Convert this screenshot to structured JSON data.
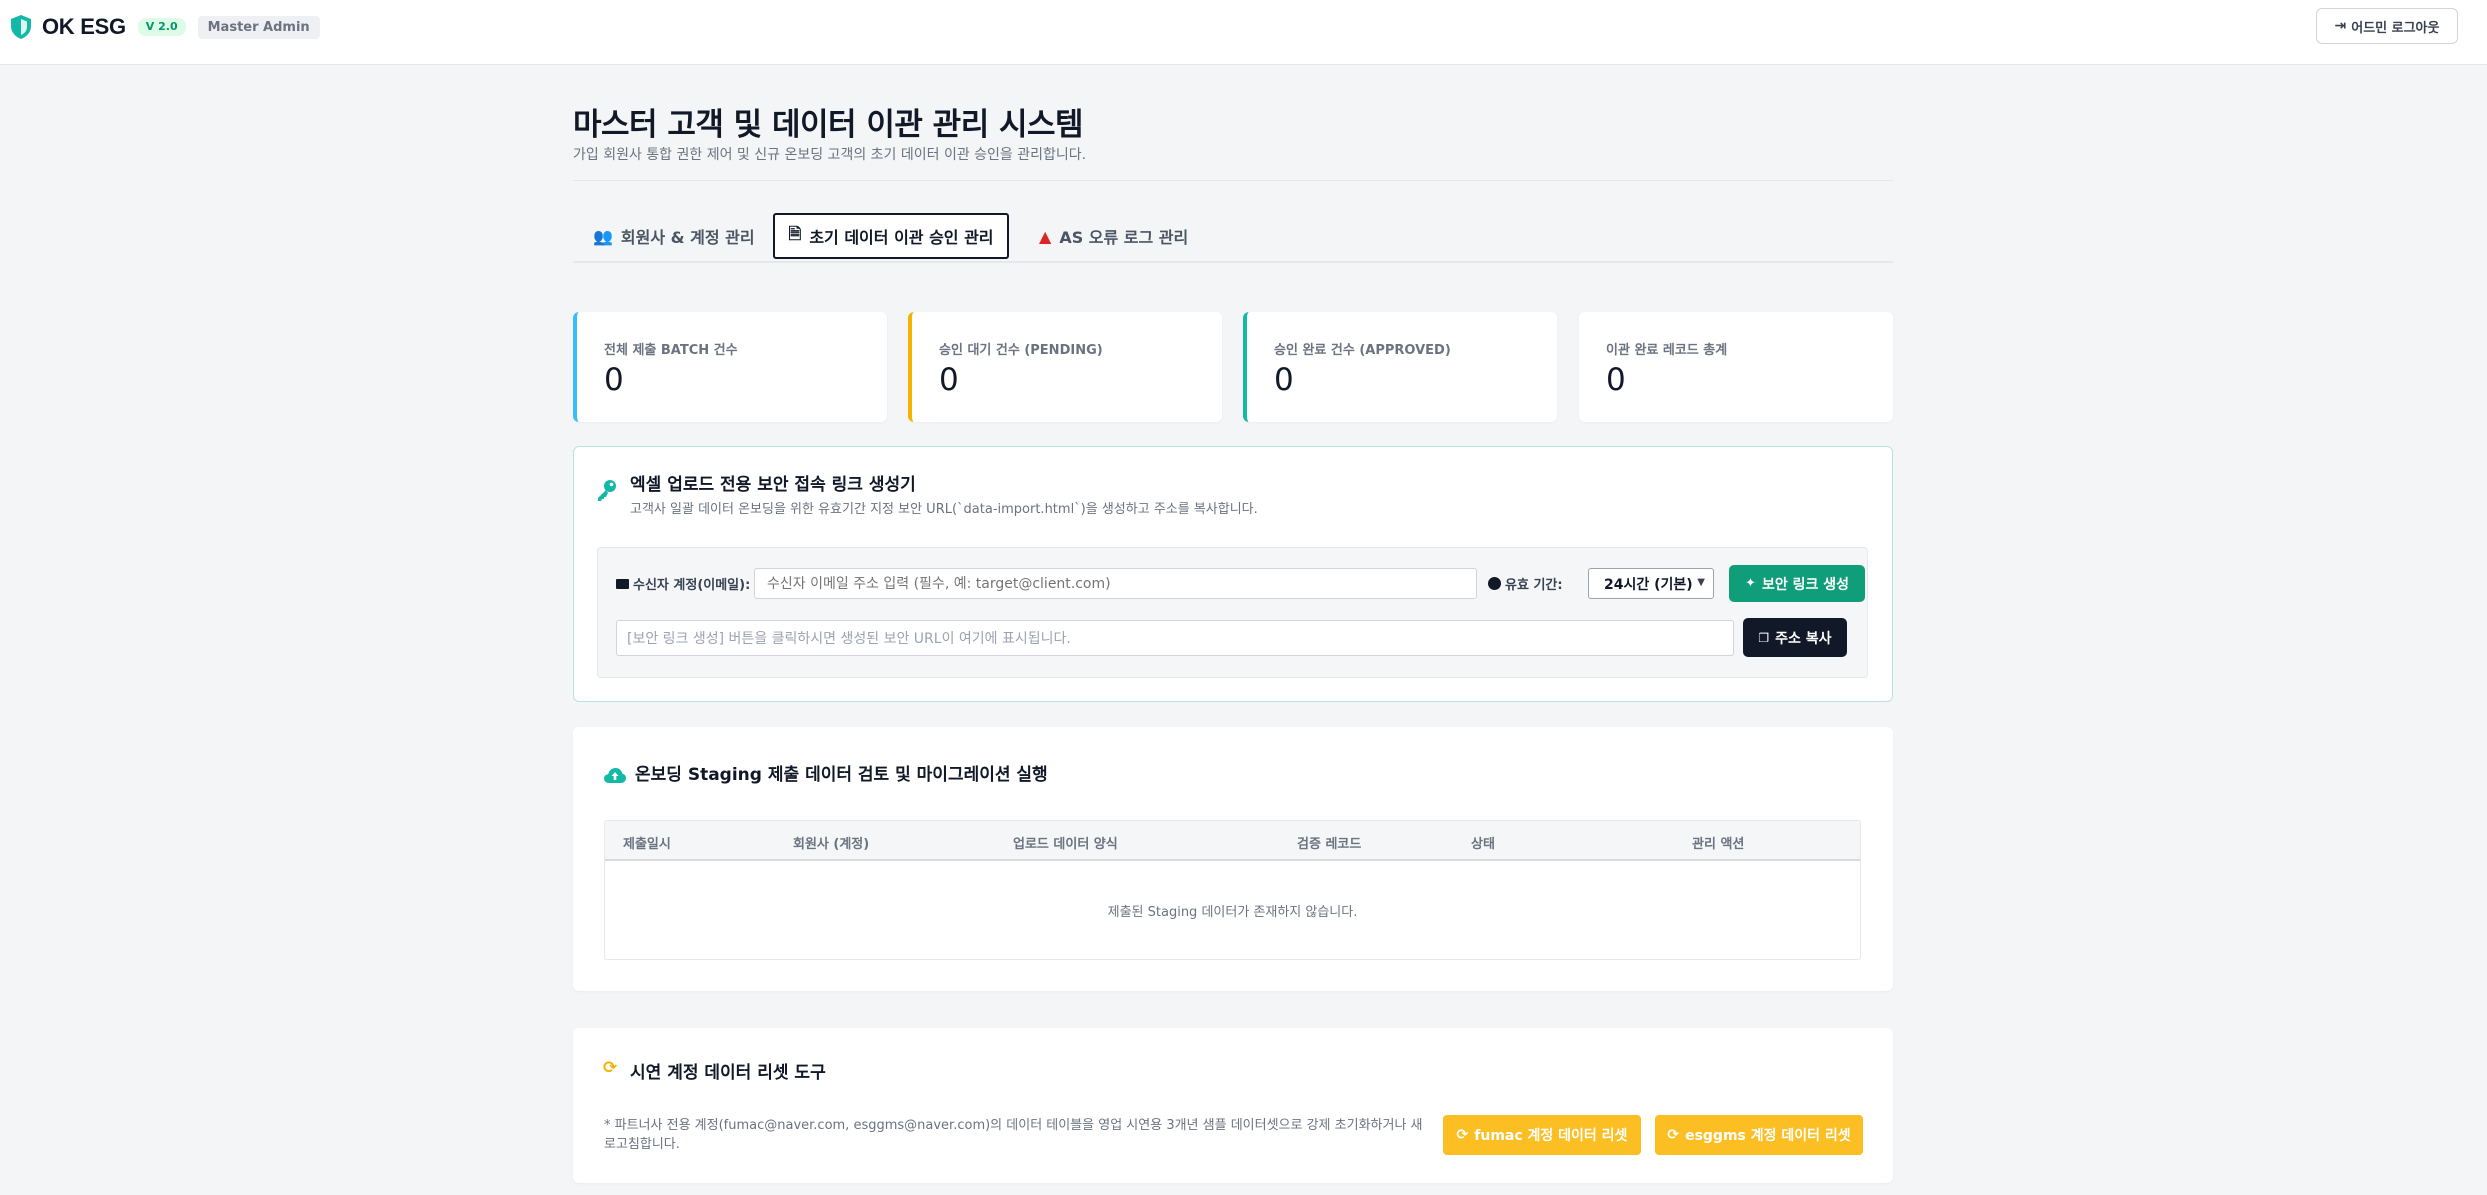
{
  "header": {
    "brand": "OK ESG",
    "version": "V 2.0",
    "role": "Master Admin",
    "logout_label": "어드민 로그아웃",
    "accent": "#14b8a6"
  },
  "page": {
    "title": "마스터 고객 및 데이터 이관 관리 시스템",
    "subtitle": "가입 회원사 통합 권한 제어 및 신규 온보딩 고객의 초기 데이터 이관 승인을 관리합니다."
  },
  "tabs": [
    {
      "label": "회원사 & 계정 관리",
      "icon": "users-icon"
    },
    {
      "label": "초기 데이터 이관 승인 관리",
      "icon": "file-import-icon",
      "active": true
    },
    {
      "label": "AS 오류 로그 관리",
      "icon": "warning-icon"
    }
  ],
  "stats": [
    {
      "label": "전체 제출 BATCH 건수",
      "value": "0"
    },
    {
      "label": "승인 대기 건수 (PENDING)",
      "value": "0"
    },
    {
      "label": "승인 완료 건수 (APPROVED)",
      "value": "0"
    },
    {
      "label": "이관 완료 레코드 총계",
      "value": "0"
    }
  ],
  "generator": {
    "title": "엑셀 업로드 전용 보안 접속 링크 생성기",
    "description": "고객사 일괄 데이터 온보딩을 위한 유효기간 지정 보안 URL(`data-import.html`)을 생성하고 주소를 복사합니다.",
    "recipient_label": "수신자 계정(이메일):",
    "recipient_placeholder": "수신자 이메일 주소 입력 (필수, 예: target@client.com)",
    "validity_label": "유효 기간:",
    "validity_selected": "24시간 (기본)",
    "generate_label": "보안 링크 생성",
    "url_placeholder": "[보안 링크 생성] 버튼을 클릭하시면 생성된 보안 URL이 여기에 표시됩니다.",
    "copy_label": "주소 복사"
  },
  "staging": {
    "title": "온보딩 Staging 제출 데이터 검토 및 마이그레이션 실행",
    "columns": [
      "제출일시",
      "회원사 (계정)",
      "업로드 데이터 양식",
      "검증 레코드",
      "상태",
      "관리 액션"
    ],
    "empty_text": "제출된 Staging 데이터가 존재하지 않습니다."
  },
  "reset": {
    "title": "시연 계정 데이터 리셋 도구",
    "note": "* 파트너사 전용 계정(fumac@naver.com, esggms@naver.com)의 데이터 테이블을 영업 시연용 3개년 샘플 데이터셋으로 강제 초기화하거나 새로고침합니다.",
    "button1": "fumac 계정 데이터 리셋",
    "button2": "esggms 계정 데이터 리셋"
  }
}
